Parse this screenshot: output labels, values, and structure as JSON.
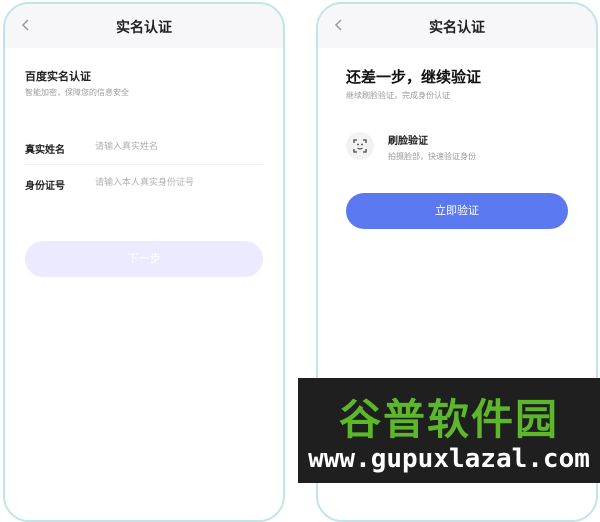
{
  "left_screen": {
    "nav_title": "实名认证",
    "section_title": "百度实名认证",
    "section_subtitle": "智能加密，保障您的信息安全",
    "fields": [
      {
        "label": "真实姓名",
        "placeholder": "请输入真实姓名"
      },
      {
        "label": "身份证号",
        "placeholder": "请输入本人真实身份证号"
      }
    ],
    "next_button": "下一步"
  },
  "right_screen": {
    "nav_title": "实名认证",
    "title": "还差一步，继续验证",
    "subtitle": "继续刷脸验证，完成身份认证",
    "option_title": "刷脸验证",
    "option_subtitle": "拍摄脸部，快速验证身份",
    "verify_button": "立即验证"
  },
  "watermark": {
    "cn": "谷普软件园",
    "url": "www.gupuxlazal.com"
  },
  "colors": {
    "primary": "#5a78f0",
    "disabled_button": "#eceaff",
    "frame": "#bfe5ea",
    "watermark_green": "#5cb82a"
  }
}
